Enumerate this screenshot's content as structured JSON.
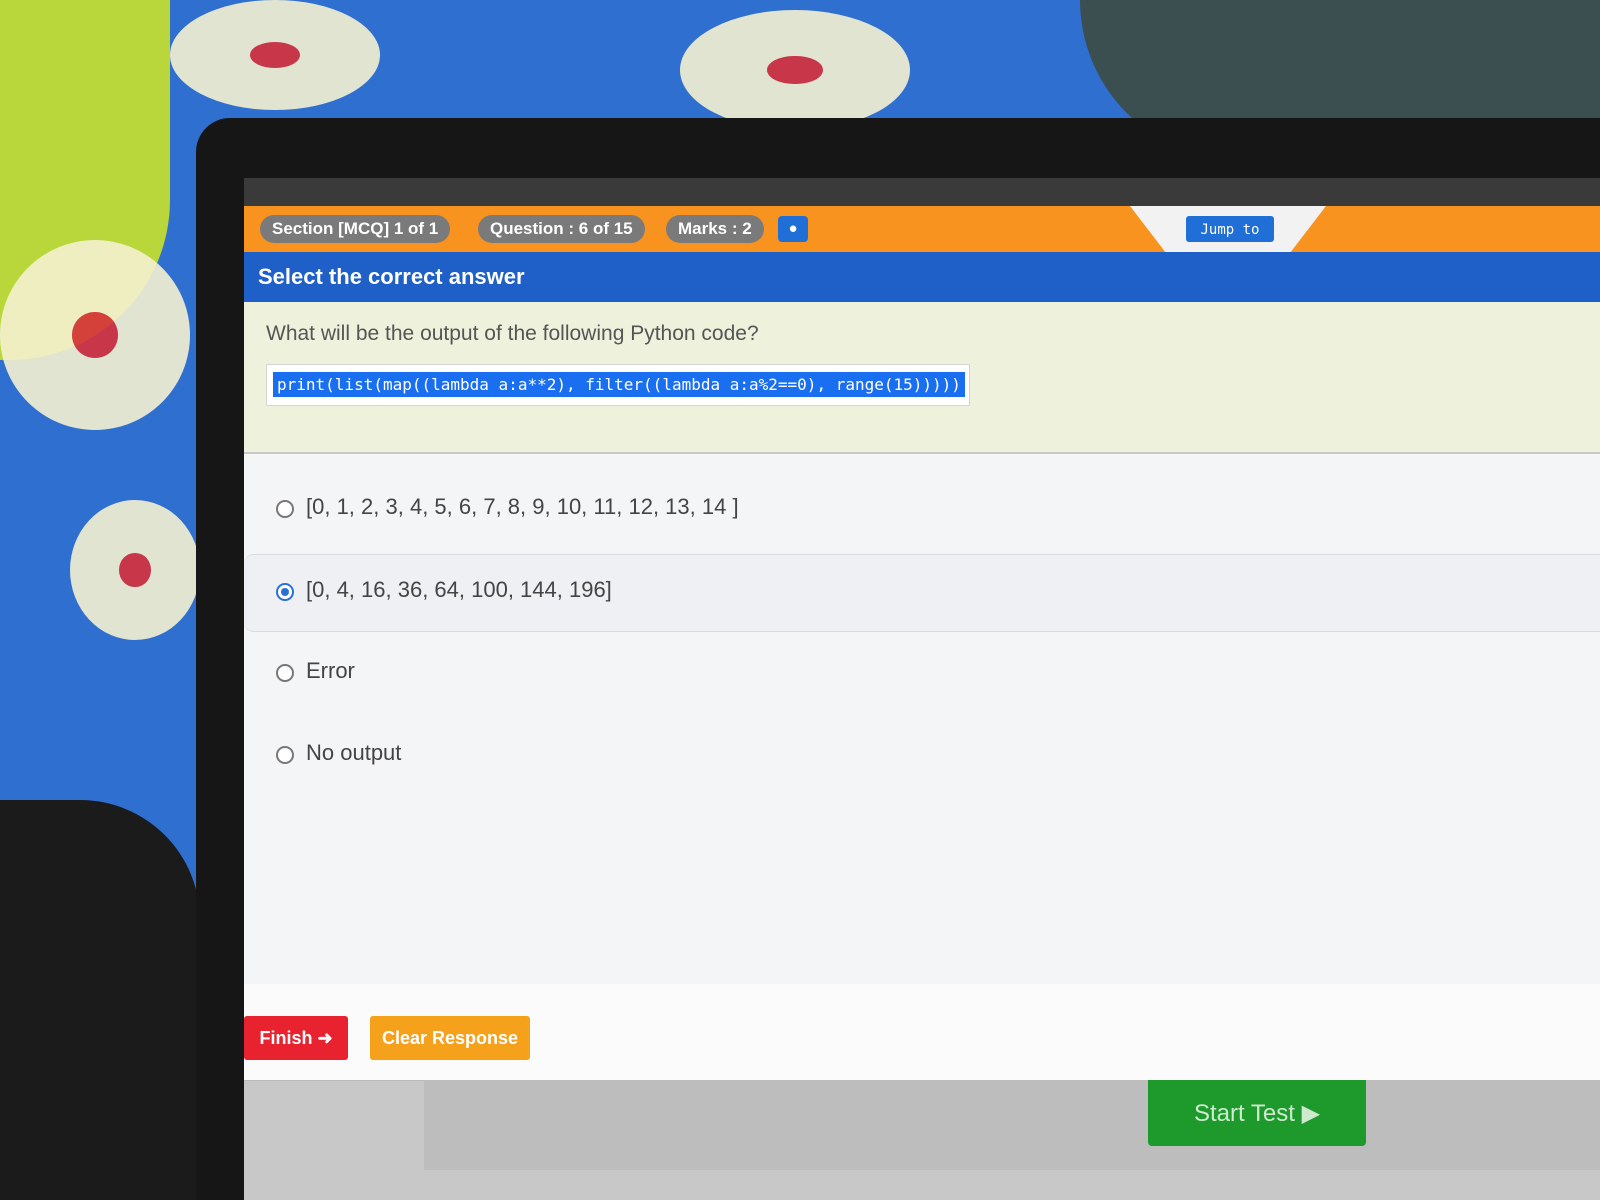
{
  "header": {
    "section_label": "Section [MCQ] 1 of 1",
    "question_label": "Question : 6 of 15",
    "marks_label": "Marks : 2",
    "chat_icon": "chat-bubble-icon",
    "jump_label": "Jump to"
  },
  "instruction": "Select the correct answer",
  "question": {
    "text": "What will be the output of the following Python code?",
    "code": "print(list(map((lambda a:a**2), filter((lambda a:a%2==0), range(15)))))"
  },
  "options": [
    {
      "label": "[0, 1, 2, 3, 4, 5, 6, 7, 8, 9, 10, 11, 12, 13, 14 ]",
      "selected": false
    },
    {
      "label": "[0, 4, 16, 36, 64, 100, 144, 196]",
      "selected": true
    },
    {
      "label": "Error",
      "selected": false
    },
    {
      "label": "No output",
      "selected": false
    }
  ],
  "footer": {
    "finish_label": "Finish ➜",
    "clear_label": "Clear Response",
    "start_label": "Start Test ▶"
  },
  "colors": {
    "orange": "#f7931e",
    "blue": "#1f5fc8",
    "finish": "#e8222e",
    "clear": "#f6a11c",
    "start": "#1d9a2b"
  }
}
